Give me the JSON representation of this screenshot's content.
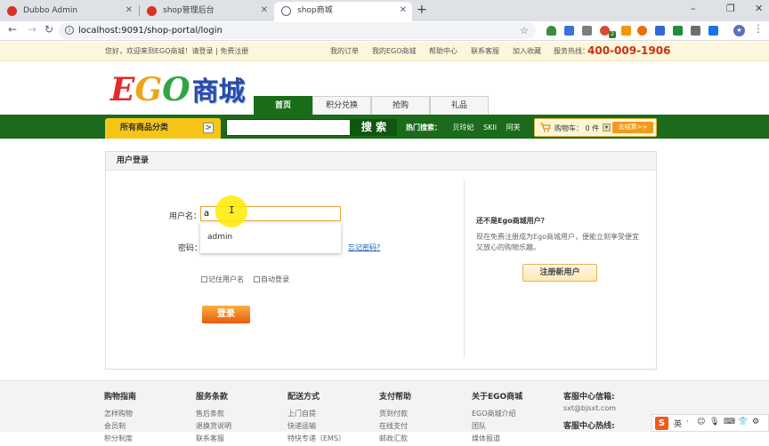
{
  "browser": {
    "tabs": [
      {
        "title": "Dubbo Admin",
        "active": false
      },
      {
        "title": "shop管理后台",
        "active": false
      },
      {
        "title": "shop商城",
        "active": true
      }
    ],
    "new_tab": "+",
    "window_controls": {
      "minimize": "–",
      "maximize": "❐",
      "close": "✕"
    },
    "nav": {
      "back": "←",
      "forward": "→",
      "reload": "↻"
    },
    "url": "localhost:9091/shop-portal/login",
    "ext_badge": "2"
  },
  "infobar": {
    "welcome": "您好，欢迎来到EGO商城！请登录 | 免费注册",
    "links": [
      "我的订单",
      "我的EGO商城",
      "帮助中心",
      "联系客服",
      "加入收藏"
    ],
    "hotline_label": "服务热线：",
    "hotline": "400-009-1906"
  },
  "logo": {
    "letters": [
      "E",
      "G",
      "O"
    ],
    "cn": "商城"
  },
  "main_tabs": [
    "首页",
    "积分兑换",
    "抢购",
    "礼品"
  ],
  "category": {
    "label": "所有商品分类",
    "arrow": ">"
  },
  "search": {
    "value": "",
    "button": "搜 索"
  },
  "hot": {
    "label": "热门搜索：",
    "items": [
      "贝玲妃",
      "SKII",
      "阿芙"
    ]
  },
  "cart": {
    "label": "购物车： 0 件",
    "dropdown": "▾",
    "checkout": "去结算>>"
  },
  "login": {
    "heading": "用户登录",
    "username_label": "用户名：",
    "username_value": "a",
    "autocomplete": [
      "admin"
    ],
    "password_label": "密码：",
    "forgot": "忘记密码?",
    "remember": "记住用户名",
    "auto_login": "自动登录",
    "submit": "登录"
  },
  "register": {
    "title": "还不是Ego商城用户？",
    "desc": "现在免费注册成为Ego商城用户，便能立刻享受便宜又放心的购物乐趣。",
    "button": "注册新用户"
  },
  "footer": {
    "columns": [
      {
        "title": "购物指南",
        "links": [
          "怎样购物",
          "会员制",
          "积分制度"
        ]
      },
      {
        "title": "服务条款",
        "links": [
          "售后条款",
          "退换货说明",
          "联系客服"
        ]
      },
      {
        "title": "配送方式",
        "links": [
          "上门自提",
          "快递运输",
          "特快专递（EMS）"
        ]
      },
      {
        "title": "支付帮助",
        "links": [
          "货到付款",
          "在线支付",
          "邮政汇款"
        ]
      },
      {
        "title": "关于EGO商城",
        "links": [
          "EGO商城介绍",
          "团队",
          "媒体报道"
        ]
      }
    ],
    "service": {
      "title": "客服中心信箱:",
      "email": "sxt@bjsxt.com",
      "hotline_title": "客服中心热线:"
    }
  },
  "ime": {
    "logo": "S",
    "items": [
      "英",
      "·",
      "☺",
      "🎙",
      "⌨",
      "👕",
      "⚙"
    ]
  },
  "colors": {
    "green": "#1b6b1b",
    "hotline": "#c8320f",
    "logo_e": "#e32b2b",
    "logo_g": "#f0a418",
    "logo_o": "#2fa544"
  }
}
